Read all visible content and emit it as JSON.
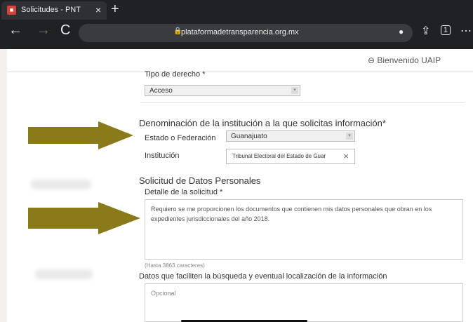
{
  "browser": {
    "tab_title": "Solicitudes - PNT",
    "tab_favicon": "PNT",
    "url": "plataformadetransparencia.org.mx",
    "tab_count": "1"
  },
  "header": {
    "welcome": "Bienvenido UAIP"
  },
  "form": {
    "tipo_label": "Tipo de derecho *",
    "tipo_value": "Acceso",
    "institution_heading": "Denominación de la institución a la que solicitas información*",
    "estado_label": "Estado o Federación",
    "estado_value": "Guanajuato",
    "institucion_label": "Institución",
    "institucion_value": "Tribunal Electoral del Estado de Guar",
    "datos_heading": "Solicitud de Datos Personales",
    "detalle_label": "Detalle de la solicitud *",
    "detalle_value": "Requiero se me proporcionen los documentos que contienen mis datos personales que obran en los expedientes jurisdiccionales del año 2018.",
    "hasta": "(Hasta 3863 caracteres)",
    "datos_busqueda_heading": "Datos que faciliten la búsqueda y eventual localización de la información",
    "opcional_placeholder": "Opcional"
  },
  "colors": {
    "arrow": "#8b7a1a",
    "browser_bg": "#202124"
  }
}
